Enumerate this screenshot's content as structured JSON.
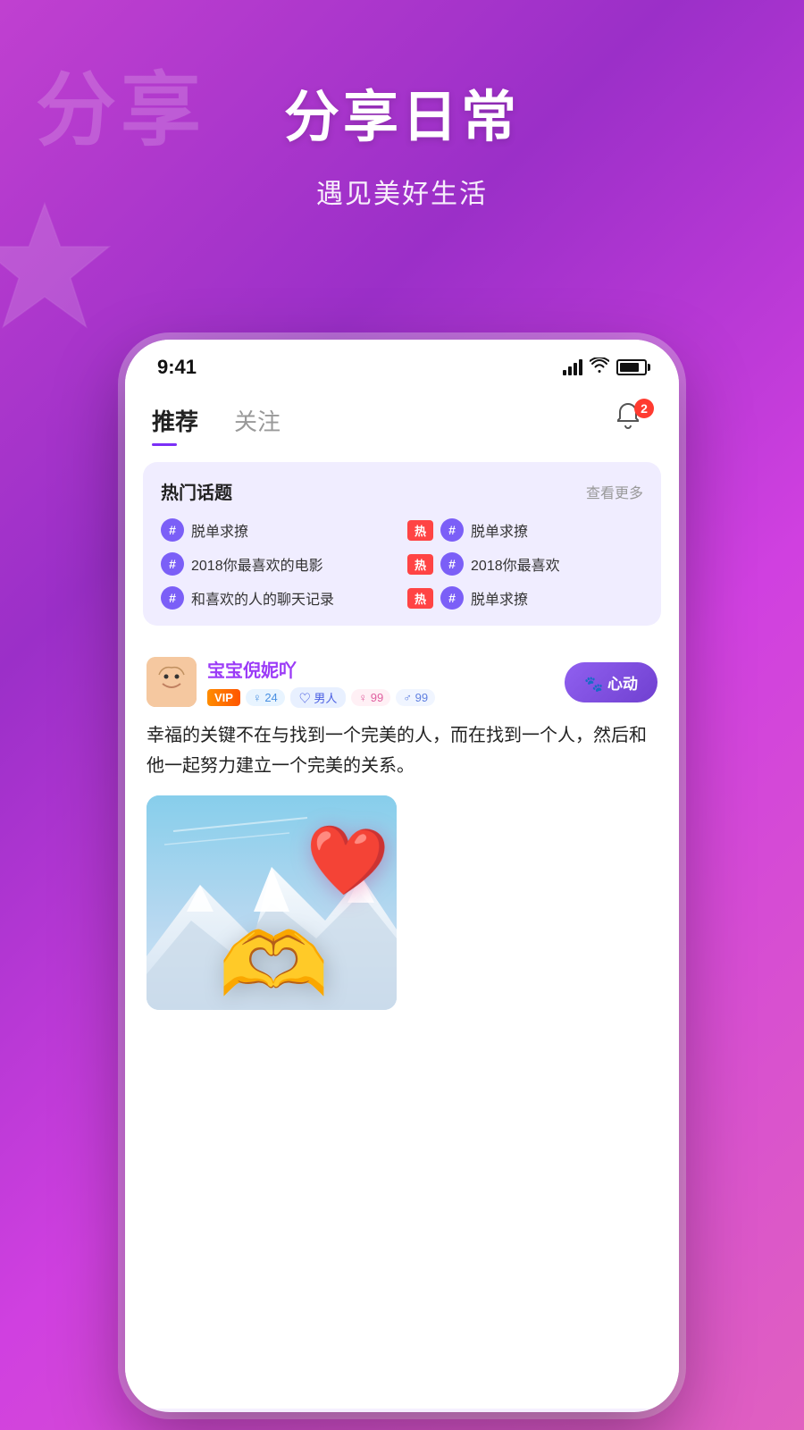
{
  "app": {
    "background_gradient": "linear-gradient(135deg, #c040d0 0%, #9b2fc8 30%, #d040e0 60%, #e060c0 100%)"
  },
  "header": {
    "bg_text": "分享",
    "main_title": "分享日常",
    "subtitle": "遇见美好生活"
  },
  "status_bar": {
    "time": "9:41",
    "badge_count": "2"
  },
  "nav": {
    "tab_active": "推荐",
    "tab_inactive": "关注",
    "bell_badge": "2"
  },
  "hot_topics": {
    "title": "热门话题",
    "more_label": "查看更多",
    "items": [
      {
        "text": "脱单求撩",
        "has_hot": false
      },
      {
        "text": "脱单求撩",
        "has_hot": true
      },
      {
        "text": "2018你最喜欢的电影",
        "has_hot": false
      },
      {
        "text": "2018你最喜欢",
        "has_hot": true
      },
      {
        "text": "和喜欢的人的聊天记录",
        "has_hot": false
      },
      {
        "text": "脱单求撩",
        "has_hot": true
      }
    ]
  },
  "post": {
    "username": "宝宝倪妮吖",
    "avatar_emoji": "👩",
    "tag_vip": "VIP",
    "tag_gender": "♀ 24",
    "tag_follow": "♡ 男人",
    "tag_count_f": "♀ 99",
    "tag_count_m": "♂ 99",
    "heart_button_label": "🐾 心动",
    "text": "幸福的关键不在与找到一个完美的人，而在找到一个人，然后和他一起努力建立一个完美的关系。"
  }
}
